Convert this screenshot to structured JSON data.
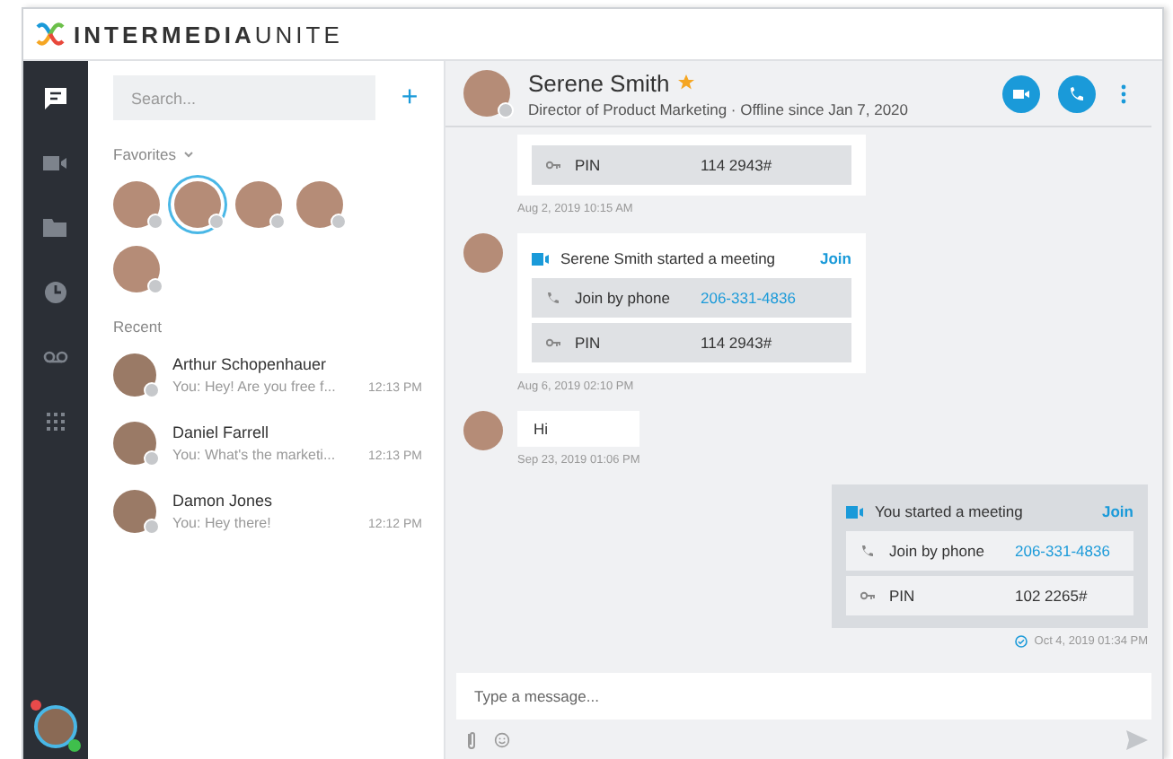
{
  "brand": {
    "name_bold": "INTERMEDIA",
    "name_light": "UNITE"
  },
  "nav": [
    {
      "kind": "chat",
      "selected": true
    },
    {
      "kind": "video",
      "selected": false
    },
    {
      "kind": "folder",
      "selected": false
    },
    {
      "kind": "clock",
      "selected": false
    },
    {
      "kind": "voicemail",
      "selected": false
    },
    {
      "kind": "dialpad",
      "selected": false
    }
  ],
  "user": {
    "notification": true,
    "online": true
  },
  "search": {
    "placeholder": "Search...",
    "add": "+"
  },
  "favorites": {
    "label": "Favorites",
    "items": [
      {
        "selected": false
      },
      {
        "selected": true
      },
      {
        "selected": false
      },
      {
        "selected": false
      },
      {
        "selected": false
      }
    ]
  },
  "recent": {
    "label": "Recent",
    "items": [
      {
        "name": "Arthur Schopenhauer",
        "preview": "You: Hey! Are you free f...",
        "time": "12:13 PM"
      },
      {
        "name": "Daniel Farrell",
        "preview": "You: What's the marketi...",
        "time": "12:13 PM"
      },
      {
        "name": "Damon Jones",
        "preview": "You: Hey there!",
        "time": "12:12 PM"
      }
    ]
  },
  "chat": {
    "name": "Serene Smith",
    "starred": true,
    "subtitle": "Director of Product Marketing · Offline since Jan 7, 2020",
    "messages": [
      {
        "kind": "meeting",
        "outgoing": false,
        "avatar": false,
        "rows": [
          {
            "kind": "pin",
            "label": "PIN",
            "value": "114 2943#"
          }
        ],
        "time": "Aug 2, 2019 10:15 AM",
        "delivered": false
      },
      {
        "kind": "meeting",
        "outgoing": false,
        "avatar": true,
        "title": "Serene Smith started a meeting",
        "action": "Join",
        "rows": [
          {
            "kind": "phone",
            "label": "Join by phone",
            "value": "206-331-4836"
          },
          {
            "kind": "pin",
            "label": "PIN",
            "value": "114 2943#"
          }
        ],
        "time": "Aug 6, 2019 02:10 PM",
        "delivered": false
      },
      {
        "kind": "text",
        "outgoing": false,
        "avatar": true,
        "text": "Hi",
        "time": "Sep 23, 2019 01:06 PM",
        "delivered": false
      },
      {
        "kind": "meeting",
        "outgoing": true,
        "avatar": false,
        "title": "You started a meeting",
        "action": "Join",
        "rows": [
          {
            "kind": "phone",
            "label": "Join by phone",
            "value": "206-331-4836"
          },
          {
            "kind": "pin",
            "label": "PIN",
            "value": "102 2265#"
          }
        ],
        "time": "Oct 4, 2019 01:34 PM",
        "delivered": true
      }
    ],
    "composer": {
      "placeholder": "Type a message..."
    }
  }
}
